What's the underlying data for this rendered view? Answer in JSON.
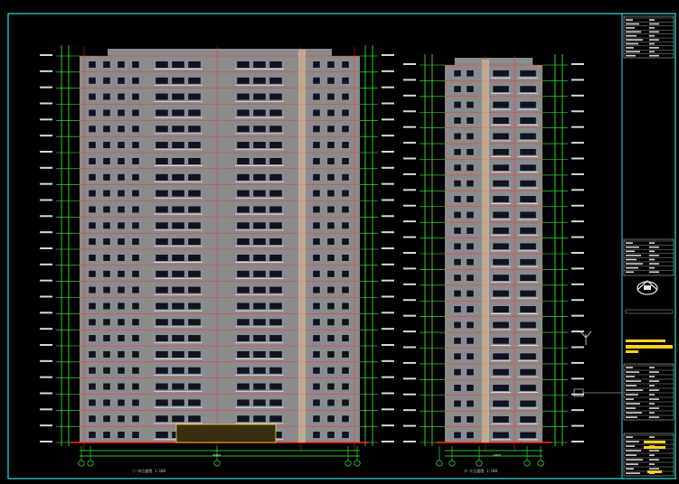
{
  "drawing": {
    "left_caption": "①-⑳立面图 1:100",
    "right_caption": "Ⓐ-Ⓚ立面图 1:100",
    "left_dim_total": "48400",
    "right_dim_total": "19600",
    "floors": 24
  },
  "title_block": {
    "company_logo": "company-logo",
    "colors": {
      "frame": "#35e0e0",
      "level_lines": "#36ff36",
      "red_lines": "#ff2a2a",
      "facade": "#8b8b8b",
      "highlight": "#ffd21e"
    }
  }
}
